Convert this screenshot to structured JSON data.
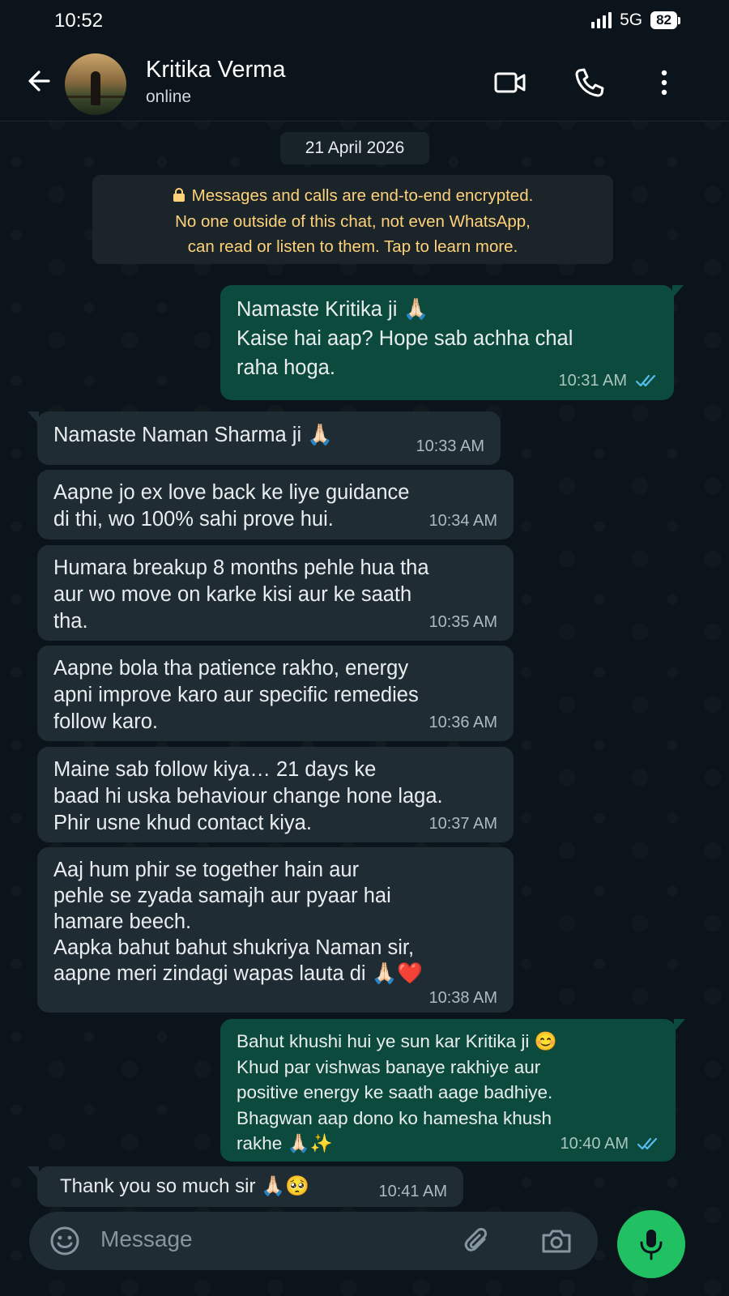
{
  "status_bar": {
    "time": "10:52",
    "network": "5G",
    "battery": "82"
  },
  "header": {
    "contact_name": "Kritika Verma",
    "contact_status": "online"
  },
  "date_chip": "21 April 2026",
  "encryption_notice": "Messages and calls are end-to-end encrypted.\nNo one outside of this chat, not even WhatsApp,\ncan read or listen to them. Tap to learn more.",
  "messages": [
    {
      "direction": "out",
      "text": "Namaste Kritika ji 🙏🏻\nKaise hai aap? Hope sab achha chal\nraha hoga.",
      "time": "10:31 AM",
      "read": true
    },
    {
      "direction": "in",
      "text": "Namaste Naman Sharma ji 🙏🏻",
      "time": "10:33 AM"
    },
    {
      "direction": "in",
      "text": "Aapne jo ex love back ke liye guidance\ndi thi, wo 100% sahi prove hui.",
      "time": "10:34 AM"
    },
    {
      "direction": "in",
      "text": "Humara breakup 8 months pehle hua tha\naur wo move on karke kisi aur ke saath\ntha.",
      "time": "10:35 AM"
    },
    {
      "direction": "in",
      "text": "Aapne bola tha patience rakho, energy\napni improve karo aur specific remedies\nfollow karo.",
      "time": "10:36 AM"
    },
    {
      "direction": "in",
      "text": "Maine sab follow kiya… 21 days ke\nbaad hi uska behaviour change hone laga.\nPhir usne khud contact kiya.",
      "time": "10:37 AM"
    },
    {
      "direction": "in",
      "text": "Aaj hum phir se together hain aur\npehle se zyada samajh aur pyaar hai\nhamare beech.\nAapka bahut bahut shukriya Naman sir,\naapne meri zindagi wapas lauta di 🙏🏻❤️",
      "time": "10:38 AM"
    },
    {
      "direction": "out",
      "text": "Bahut khushi hui ye sun kar Kritika ji 😊\nKhud par vishwas banaye rakhiye aur\npositive energy ke saath aage badhiye.\nBhagwan aap dono ko hamesha khush\nrakhe 🙏🏻✨",
      "time": "10:40 AM",
      "read": true
    },
    {
      "direction": "in",
      "text": "Thank you so much sir 🙏🏻🥺",
      "time": "10:41 AM"
    }
  ],
  "input": {
    "placeholder": "Message"
  },
  "icons": {
    "back": "arrow-left-icon",
    "video": "video-call-icon",
    "call": "phone-icon",
    "menu": "more-vertical-icon",
    "lock": "lock-icon",
    "read": "double-check-icon",
    "emoji": "emoji-icon",
    "attach": "paperclip-icon",
    "camera": "camera-icon",
    "mic": "microphone-icon"
  },
  "colors": {
    "background": "#0b141a",
    "incoming_bubble": "#202c33",
    "outgoing_bubble": "#0b4a3d",
    "read_tick": "#53bdeb",
    "encryption_text": "#ffd279",
    "mic_button": "#21c063"
  }
}
